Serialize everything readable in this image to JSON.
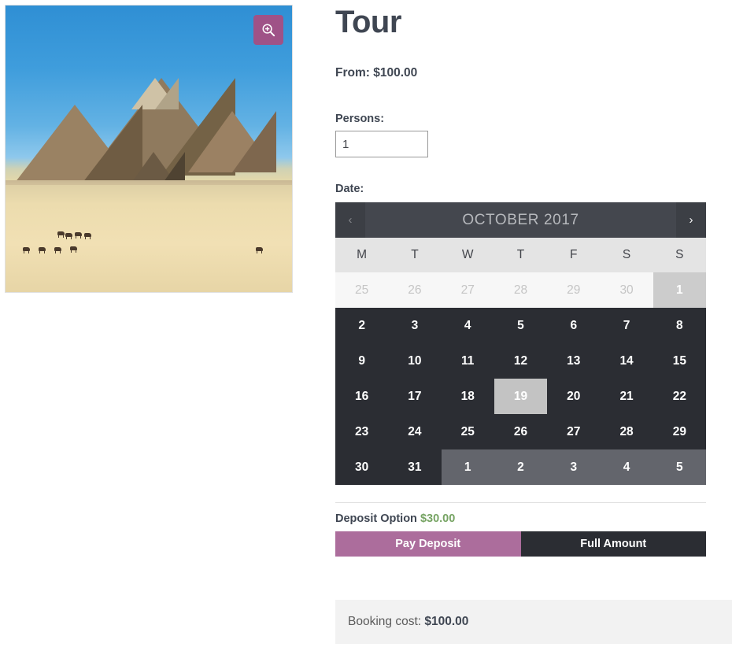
{
  "gallery": {
    "alt_name": "pyramids-of-giza-photo",
    "zoom_button": {
      "name": "zoom-image-button",
      "label": "",
      "color": "#9f5287"
    }
  },
  "product": {
    "title": "Tour",
    "price_from_label": "From: $100.00",
    "persons_label": "Persons:",
    "persons_value": "1",
    "persons_placeholder": "1",
    "date_label": "Date:"
  },
  "calendar": {
    "month_title": "OCTOBER 2017",
    "prev_label": "‹",
    "next_label": "›",
    "weekdays": [
      "M",
      "T",
      "W",
      "T",
      "F",
      "S",
      "S"
    ],
    "selected_day": "19",
    "days": [
      {
        "label": "25",
        "state": "other-prev"
      },
      {
        "label": "26",
        "state": "other-prev"
      },
      {
        "label": "27",
        "state": "other-prev"
      },
      {
        "label": "28",
        "state": "other-prev"
      },
      {
        "label": "29",
        "state": "other-prev"
      },
      {
        "label": "30",
        "state": "other-prev"
      },
      {
        "label": "1",
        "state": "unavailable"
      },
      {
        "label": "2",
        "state": "available"
      },
      {
        "label": "3",
        "state": "available"
      },
      {
        "label": "4",
        "state": "available"
      },
      {
        "label": "5",
        "state": "available"
      },
      {
        "label": "6",
        "state": "available"
      },
      {
        "label": "7",
        "state": "available"
      },
      {
        "label": "8",
        "state": "available"
      },
      {
        "label": "9",
        "state": "available"
      },
      {
        "label": "10",
        "state": "available"
      },
      {
        "label": "11",
        "state": "available"
      },
      {
        "label": "12",
        "state": "available"
      },
      {
        "label": "13",
        "state": "available"
      },
      {
        "label": "14",
        "state": "available"
      },
      {
        "label": "15",
        "state": "available"
      },
      {
        "label": "16",
        "state": "available"
      },
      {
        "label": "17",
        "state": "available"
      },
      {
        "label": "18",
        "state": "available"
      },
      {
        "label": "19",
        "state": "selected"
      },
      {
        "label": "20",
        "state": "available"
      },
      {
        "label": "21",
        "state": "available"
      },
      {
        "label": "22",
        "state": "available"
      },
      {
        "label": "23",
        "state": "available"
      },
      {
        "label": "24",
        "state": "available"
      },
      {
        "label": "25",
        "state": "available"
      },
      {
        "label": "26",
        "state": "available"
      },
      {
        "label": "27",
        "state": "available"
      },
      {
        "label": "28",
        "state": "available"
      },
      {
        "label": "29",
        "state": "available"
      },
      {
        "label": "30",
        "state": "available"
      },
      {
        "label": "31",
        "state": "available"
      },
      {
        "label": "1",
        "state": "other-next"
      },
      {
        "label": "2",
        "state": "other-next"
      },
      {
        "label": "3",
        "state": "other-next"
      },
      {
        "label": "4",
        "state": "other-next"
      },
      {
        "label": "5",
        "state": "other-next"
      }
    ]
  },
  "deposit": {
    "title": "Deposit Option",
    "amount": "$30.00",
    "amount_color": "#77a464",
    "pay_deposit_label": "Pay Deposit",
    "full_amount_label": "Full Amount",
    "active_option": "Pay Deposit",
    "active_color": "#ac6d9c"
  },
  "booking": {
    "cost_prefix": "Booking cost: ",
    "cost_value": "$100.00"
  }
}
